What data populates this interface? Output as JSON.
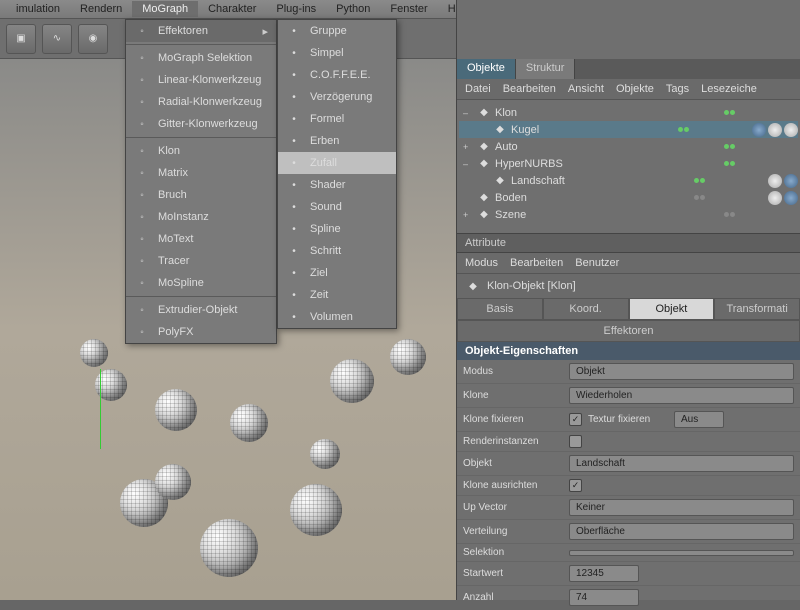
{
  "menubar": {
    "items": [
      "imulation",
      "Rendern",
      "MoGraph",
      "Charakter",
      "Plug-ins",
      "Python",
      "Fenster",
      "Hilfe"
    ],
    "active_index": 2
  },
  "dropdown": {
    "items": [
      {
        "label": "Effektoren",
        "arrow": true,
        "hover": true
      },
      {
        "sep": true
      },
      {
        "label": "MoGraph Selektion"
      },
      {
        "label": "Linear-Klonwerkzeug"
      },
      {
        "label": "Radial-Klonwerkzeug"
      },
      {
        "label": "Gitter-Klonwerkzeug"
      },
      {
        "sep": true
      },
      {
        "label": "Klon"
      },
      {
        "label": "Matrix"
      },
      {
        "label": "Bruch"
      },
      {
        "label": "MoInstanz"
      },
      {
        "label": "MoText"
      },
      {
        "label": "Tracer"
      },
      {
        "label": "MoSpline"
      },
      {
        "sep": true
      },
      {
        "label": "Extrudier-Objekt"
      },
      {
        "label": "PolyFX"
      }
    ]
  },
  "submenu": {
    "items": [
      {
        "label": "Gruppe"
      },
      {
        "label": "Simpel"
      },
      {
        "sep": true
      },
      {
        "label": "C.O.F.F.E.E."
      },
      {
        "label": "Verzögerung"
      },
      {
        "label": "Formel"
      },
      {
        "label": "Erben"
      },
      {
        "label": "Zufall",
        "hl": true
      },
      {
        "label": "Shader"
      },
      {
        "label": "Sound"
      },
      {
        "label": "Spline"
      },
      {
        "label": "Schritt"
      },
      {
        "label": "Ziel"
      },
      {
        "label": "Zeit"
      },
      {
        "label": "Volumen"
      }
    ]
  },
  "objects_panel": {
    "tabs": [
      "Objekte",
      "Struktur"
    ],
    "active_tab": 0,
    "bar": [
      "Datei",
      "Bearbeiten",
      "Ansicht",
      "Objekte",
      "Tags",
      "Lesezeiche"
    ],
    "tree": [
      {
        "indent": 0,
        "exp": "–",
        "name": "Klon",
        "dots": "gg",
        "tags": []
      },
      {
        "indent": 1,
        "exp": "",
        "name": "Kugel",
        "sel": true,
        "dots": "gg",
        "tags": [
          "b",
          "w",
          "w"
        ]
      },
      {
        "indent": 0,
        "exp": "+",
        "name": "Auto",
        "dots": "gg",
        "tags": []
      },
      {
        "indent": 0,
        "exp": "–",
        "name": "HyperNURBS",
        "dots": "gg",
        "tags": []
      },
      {
        "indent": 1,
        "exp": "",
        "name": "Landschaft",
        "dots": "gg",
        "tags": [
          "w",
          "b"
        ]
      },
      {
        "indent": 0,
        "exp": "",
        "name": "Boden",
        "dots": "",
        "tags": [
          "w",
          "b"
        ]
      },
      {
        "indent": 0,
        "exp": "+",
        "name": "Szene",
        "dots": "",
        "tags": []
      }
    ]
  },
  "attributes": {
    "title": "Attribute",
    "bar": [
      "Modus",
      "Bearbeiten",
      "Benutzer"
    ],
    "object_title": "Klon-Objekt [Klon]",
    "tabs": [
      "Basis",
      "Koord.",
      "Objekt",
      "Transformati",
      "Effektoren"
    ],
    "active_tab": 2,
    "section": "Objekt-Eigenschaften",
    "props": {
      "modus_label": "Modus",
      "modus_value": "Objekt",
      "klone_label": "Klone",
      "klone_value": "Wiederholen",
      "klone_fix_label": "Klone fixieren",
      "klone_fix_checked": true,
      "textur_fix_label": "Textur fixieren",
      "textur_fix_value": "Aus",
      "render_label": "Renderinstanzen",
      "render_checked": false,
      "objekt_label": "Objekt",
      "objekt_value": "Landschaft",
      "ausrichten_label": "Klone ausrichten",
      "ausrichten_checked": true,
      "upvector_label": "Up Vector",
      "upvector_value": "Keiner",
      "verteilung_label": "Verteilung",
      "verteilung_value": "Oberfläche",
      "selektion_label": "Selektion",
      "selektion_value": "",
      "startwert_label": "Startwert",
      "startwert_value": "12345",
      "anzahl_label": "Anzahl",
      "anzahl_value": "74"
    }
  }
}
